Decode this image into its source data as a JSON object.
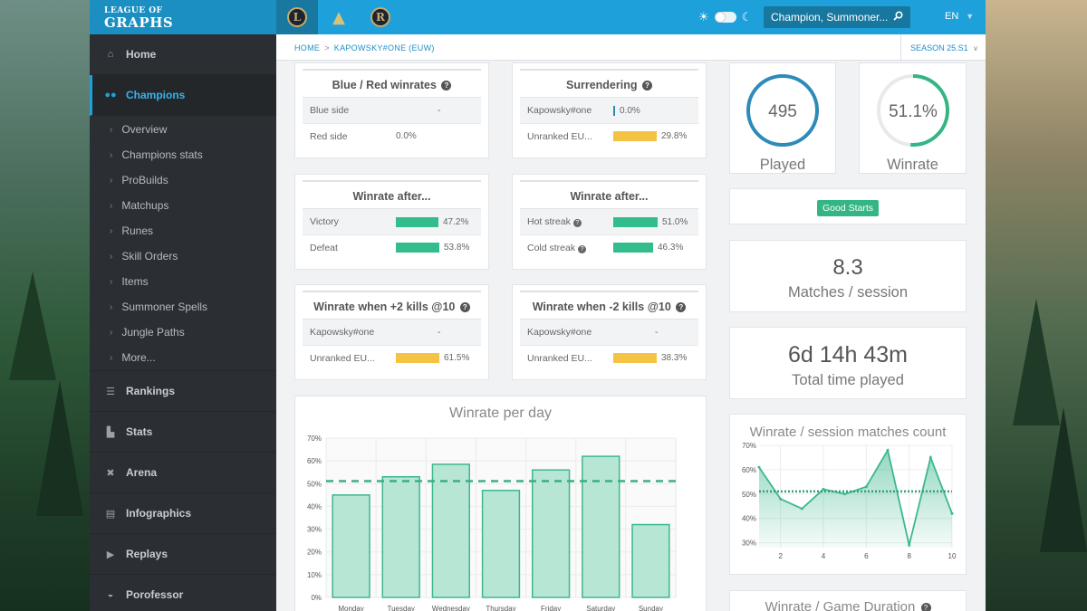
{
  "header": {
    "logo_line1": "LEAGUE OF",
    "logo_line2": "GRAPHS",
    "game_tabs": [
      "L",
      "T",
      "R"
    ],
    "search_placeholder": "Champion, Summoner...",
    "language": "EN"
  },
  "sidebar": {
    "items": [
      {
        "label": "Home",
        "icon": "home-icon"
      },
      {
        "label": "Champions",
        "icon": "users-icon",
        "active": true
      },
      {
        "label": "Rankings",
        "icon": "list-icon"
      },
      {
        "label": "Stats",
        "icon": "bar-chart-icon"
      },
      {
        "label": "Arena",
        "icon": "arena-icon"
      },
      {
        "label": "Infographics",
        "icon": "infographic-icon"
      },
      {
        "label": "Replays",
        "icon": "play-icon"
      },
      {
        "label": "Porofessor",
        "icon": "porofessor-icon"
      }
    ],
    "sub_items": [
      "Overview",
      "Champions stats",
      "ProBuilds",
      "Matchups",
      "Runes",
      "Skill Orders",
      "Items",
      "Summoner Spells",
      "Jungle Paths",
      "More..."
    ]
  },
  "breadcrumb": {
    "home": "HOME",
    "sep": ">",
    "current": "KAPOWSKY#ONE (EUW)"
  },
  "season": "SEASON 25.S1",
  "boxes": {
    "blue_red": {
      "title": "Blue / Red winrates",
      "rows": [
        {
          "label": "Blue side",
          "value": "-",
          "fraction": 0,
          "color": "none"
        },
        {
          "label": "Red side",
          "value": "0.0%",
          "fraction": 0,
          "color": "none"
        }
      ]
    },
    "surrendering": {
      "title": "Surrendering",
      "rows": [
        {
          "label": "Kapowsky#one",
          "value": "0.0%",
          "fraction": 0,
          "color": "blue"
        },
        {
          "label": "Unranked EU...",
          "value": "29.8%",
          "fraction": 0.298,
          "color": "yellow"
        }
      ]
    },
    "winrate_after_1": {
      "title": "Winrate after...",
      "rows": [
        {
          "label": "Victory",
          "value": "47.2%",
          "fraction": 0.472,
          "color": "green"
        },
        {
          "label": "Defeat",
          "value": "53.8%",
          "fraction": 0.538,
          "color": "green"
        }
      ]
    },
    "winrate_after_2": {
      "title": "Winrate after...",
      "rows": [
        {
          "label": "Hot streak",
          "value": "51.0%",
          "fraction": 0.51,
          "color": "green",
          "help": true
        },
        {
          "label": "Cold streak",
          "value": "46.3%",
          "fraction": 0.463,
          "color": "green",
          "help": true
        }
      ]
    },
    "plus2": {
      "title": "Winrate when +2 kills @10",
      "rows": [
        {
          "label": "Kapowsky#one",
          "value": "-",
          "fraction": 0,
          "color": "none"
        },
        {
          "label": "Unranked EU...",
          "value": "61.5%",
          "fraction": 0.615,
          "color": "yellow"
        }
      ]
    },
    "minus2": {
      "title": "Winrate when -2 kills @10",
      "rows": [
        {
          "label": "Kapowsky#one",
          "value": "-",
          "fraction": 0,
          "color": "none"
        },
        {
          "label": "Unranked EU...",
          "value": "38.3%",
          "fraction": 0.383,
          "color": "yellow"
        }
      ]
    }
  },
  "stats": {
    "played": {
      "value": "495",
      "caption": "Played",
      "fraction": 1.0,
      "color": "#2c8bb8"
    },
    "winrate": {
      "value": "51.1%",
      "caption": "Winrate",
      "fraction": 0.511,
      "color": "#33b584"
    },
    "badge": "Good Starts",
    "matches_session": {
      "value": "8.3",
      "caption": "Matches / session"
    },
    "total_time": {
      "value": "6d 14h 43m",
      "caption": "Total time played"
    },
    "next_title": "Winrate / Game Duration"
  },
  "chart_data": [
    {
      "type": "bar",
      "title": "Winrate per day",
      "categories": [
        "Monday",
        "Tuesday",
        "Wednesday",
        "Thursday",
        "Friday",
        "Saturday",
        "Sunday"
      ],
      "values": [
        45,
        53,
        58.5,
        47,
        56,
        62,
        32
      ],
      "average_line": 51.1,
      "ylim": [
        0,
        70
      ],
      "yticks": [
        "0%",
        "10%",
        "20%",
        "30%",
        "40%",
        "50%",
        "60%",
        "70%"
      ],
      "bar_color": "#b8e6d5",
      "bar_border": "#3cb88c"
    },
    {
      "type": "area",
      "title": "Winrate / session matches count",
      "x": [
        1,
        2,
        3,
        4,
        5,
        6,
        7,
        8,
        9,
        10
      ],
      "values": [
        61,
        48,
        44,
        52,
        50,
        53,
        68,
        29,
        65,
        42
      ],
      "average_line": 51.1,
      "ylim": [
        28,
        70
      ],
      "yticks": [
        {
          "v": 30,
          "l": "30%"
        },
        {
          "v": 40,
          "l": "40%"
        },
        {
          "v": 50,
          "l": "50%"
        },
        {
          "v": 60,
          "l": "60%"
        },
        {
          "v": 70,
          "l": "70%"
        }
      ],
      "xticks": [
        2,
        4,
        6,
        8,
        10
      ],
      "line_color": "#3cb88c"
    }
  ]
}
